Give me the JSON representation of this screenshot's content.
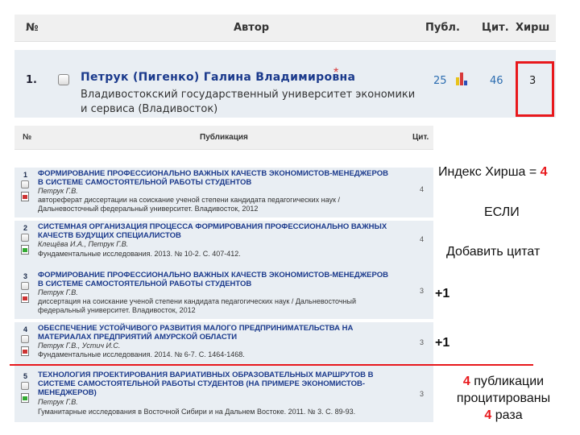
{
  "author_table": {
    "headers": {
      "num": "№",
      "author": "Автор",
      "publ": "Публ.",
      "cit": "Цит.",
      "hirsch": "Хирш"
    },
    "row": {
      "num": "1.",
      "name": "Петрук (Пигенко) Галина Владимировна",
      "star": "*",
      "org": "Владивостокский государственный университет экономики и сервиса (Владивосток)",
      "publ": "25",
      "cit": "46",
      "hirsch": "3"
    }
  },
  "pub_table": {
    "headers": {
      "num": "№",
      "title": "Публикация",
      "cit": "Цит."
    },
    "rows": [
      {
        "num": "1",
        "title": "Формирование профессионально важных качеств экономистов-менеджеров в системе самостоятельной работы студентов",
        "authors": "Петрук Г.В.",
        "source": "автореферат диссертации на соискание ученой степени кандидата педагогических наук / Дальневосточный федеральный университет. Владивосток, 2012",
        "cit": "4"
      },
      {
        "num": "2",
        "title": "Системная организация процесса формирования профессионально важных качеств будущих специалистов",
        "authors": "Клещёва И.А., Петрук Г.В.",
        "source": "Фундаментальные исследования. 2013. № 10-2. С. 407-412.",
        "cit": "4"
      },
      {
        "num": "3",
        "title": "Формирование профессионально важных качеств экономистов-менеджеров в системе самостоятельной работы студентов",
        "authors": "Петрук Г.В.",
        "source": "диссертация на соискание ученой степени кандидата педагогических наук / Дальневосточный федеральный университет. Владивосток, 2012",
        "cit": "3"
      },
      {
        "num": "4",
        "title": "Обеспечение устойчивого развития малого предпринимательства на материалах предприятий Амурской области",
        "authors": "Петрук Г.В., Устич И.С.",
        "source": "Фундаментальные исследования. 2014. № 6-7. С. 1464-1468.",
        "cit": "3"
      },
      {
        "num": "5",
        "title": "Технология проектирования вариативных образовательных маршрутов в системе самостоятельной работы студентов (на примере экономистов-менеджеров)",
        "authors": "Петрук Г.В.",
        "source": "Гуманитарные исследования в Восточной Сибири и на Дальнем Востоке. 2011. № 3. С. 89-93.",
        "cit": "3"
      }
    ]
  },
  "annotation": {
    "hirsch_prefix": "Индекс Хирша = ",
    "hirsch_value": "4",
    "if_text": "ЕСЛИ",
    "add_text": "Добавить цитат",
    "plus1_a": "+1",
    "plus1_b": "+1",
    "result_num": "4",
    "result_line1": " публикации",
    "result_line2": "процитированы",
    "result_num2": "4",
    "result_line3": " раза"
  },
  "colors": {
    "accent_red": "#e8181c",
    "link_blue": "#1b3a8c"
  }
}
